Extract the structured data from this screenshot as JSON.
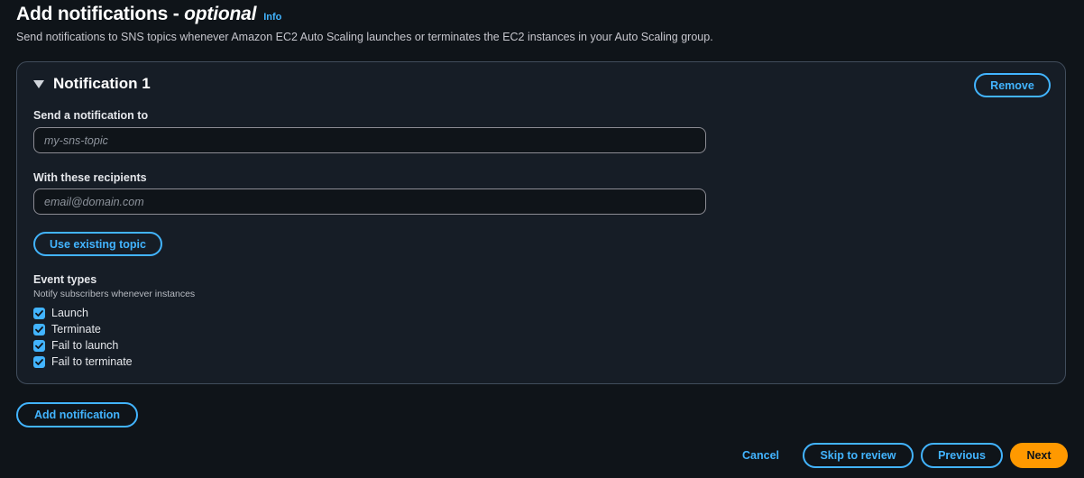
{
  "header": {
    "title_main": "Add notifications - ",
    "title_optional": "optional",
    "info_link": "Info",
    "description": "Send notifications to SNS topics whenever Amazon EC2 Auto Scaling launches or terminates the EC2 instances in your Auto Scaling group."
  },
  "notification": {
    "title": "Notification 1",
    "remove_label": "Remove",
    "send_to_label": "Send a notification to",
    "send_to_placeholder": "my-sns-topic",
    "send_to_value": "",
    "recipients_label": "With these recipients",
    "recipients_placeholder": "email@domain.com",
    "recipients_value": "",
    "use_existing_label": "Use existing topic",
    "event_types_label": "Event types",
    "event_types_description": "Notify subscribers whenever instances",
    "event_types": [
      {
        "label": "Launch",
        "checked": true
      },
      {
        "label": "Terminate",
        "checked": true
      },
      {
        "label": "Fail to launch",
        "checked": true
      },
      {
        "label": "Fail to terminate",
        "checked": true
      }
    ]
  },
  "add_notification_label": "Add notification",
  "footer": {
    "cancel_label": "Cancel",
    "skip_label": "Skip to review",
    "previous_label": "Previous",
    "next_label": "Next"
  },
  "colors": {
    "background": "#0f1419",
    "panel": "#161d26",
    "accent_blue": "#42b4ff",
    "primary_orange": "#ff9900"
  },
  "icons": {
    "caret": "caret-down-icon",
    "checkbox_check": "checkmark-icon"
  }
}
